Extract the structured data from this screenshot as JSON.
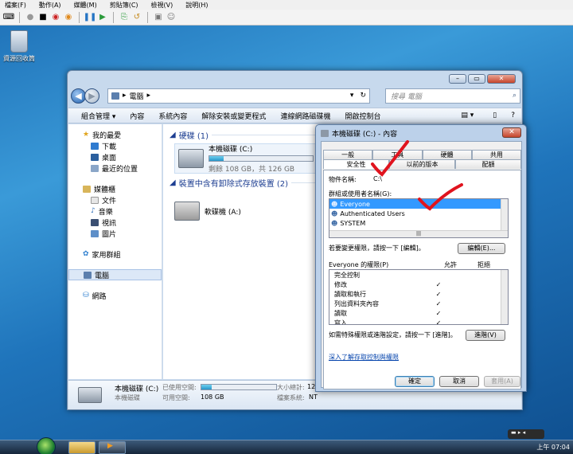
{
  "vm_menu": [
    "檔案(F)",
    "動作(A)",
    "媒體(M)",
    "剪貼簿(C)",
    "檢視(V)",
    "說明(H)"
  ],
  "desktop": {
    "recycle_label": "資源回收筒"
  },
  "explorer": {
    "address": "電腦",
    "search_placeholder": "搜尋 電腦",
    "commands": [
      "組合管理 ▾",
      "內容",
      "系統內容",
      "解除安裝或變更程式",
      "連線網路磁碟機",
      "開啟控制台"
    ],
    "nav": {
      "favorites": "我的最愛",
      "fav_items": [
        "下載",
        "桌面",
        "最近的位置"
      ],
      "libraries": "媒體櫃",
      "lib_items": [
        "文件",
        "音樂",
        "視訊",
        "圖片"
      ],
      "homegroup": "家用群組",
      "computer": "電腦",
      "network": "網路"
    },
    "groups": {
      "hdd_title": "硬碟 (1)",
      "removable_title": "裝置中含有卸除式存放裝置 (2)"
    },
    "drive_c": {
      "name": "本機磁碟 (C:)",
      "free_text": "剩餘 108 GB，共 126 GB",
      "used_fraction": 0.14
    },
    "drive_a": {
      "name": "軟碟機 (A:)"
    },
    "details": {
      "name": "本機磁碟 (C:)",
      "type": "本機磁碟",
      "used_label": "已使用空間:",
      "free_label": "可用空間:",
      "free_value": "108 GB",
      "total_label": "大小總計:",
      "total_value": "12",
      "fs_label": "檔案系統:",
      "fs_value": "NT"
    }
  },
  "props": {
    "title": "本機磁碟 (C:) - 內容",
    "close": "✕",
    "tabs_top": [
      "一般",
      "工具",
      "硬體",
      "共用"
    ],
    "tabs_bottom": [
      "安全性",
      "以前的版本",
      "配額"
    ],
    "object_label": "物件名稱:",
    "object_value": "C:\\",
    "groups_label": "群組或使用者名稱(G):",
    "users": [
      "Everyone",
      "Authenticated Users",
      "SYSTEM"
    ],
    "edit_hint": "若要變更權限，請按一下 [編輯]。",
    "edit_btn": "編輯(E)...",
    "perm_header": "Everyone 的權限(P)",
    "allow": "允許",
    "deny": "拒絕",
    "permissions": [
      "完全控制",
      "修改",
      "讀取和執行",
      "列出資料夾內容",
      "讀取",
      "寫入"
    ],
    "allowed_flags": [
      false,
      true,
      true,
      true,
      true,
      true
    ],
    "check_mark": "✓",
    "advanced_hint": "如需特殊權限或進階設定，請按一下 [進階]。",
    "advanced_btn": "進階(V)",
    "link": "深入了解存取控制與權限",
    "ok": "確定",
    "cancel": "取消",
    "apply": "套用(A)"
  },
  "taskbar": {
    "clock": "上午 07:04"
  },
  "colors": {
    "annotation": "#e0141e",
    "selection": "#3399ff",
    "group_title": "#1e3f92"
  }
}
